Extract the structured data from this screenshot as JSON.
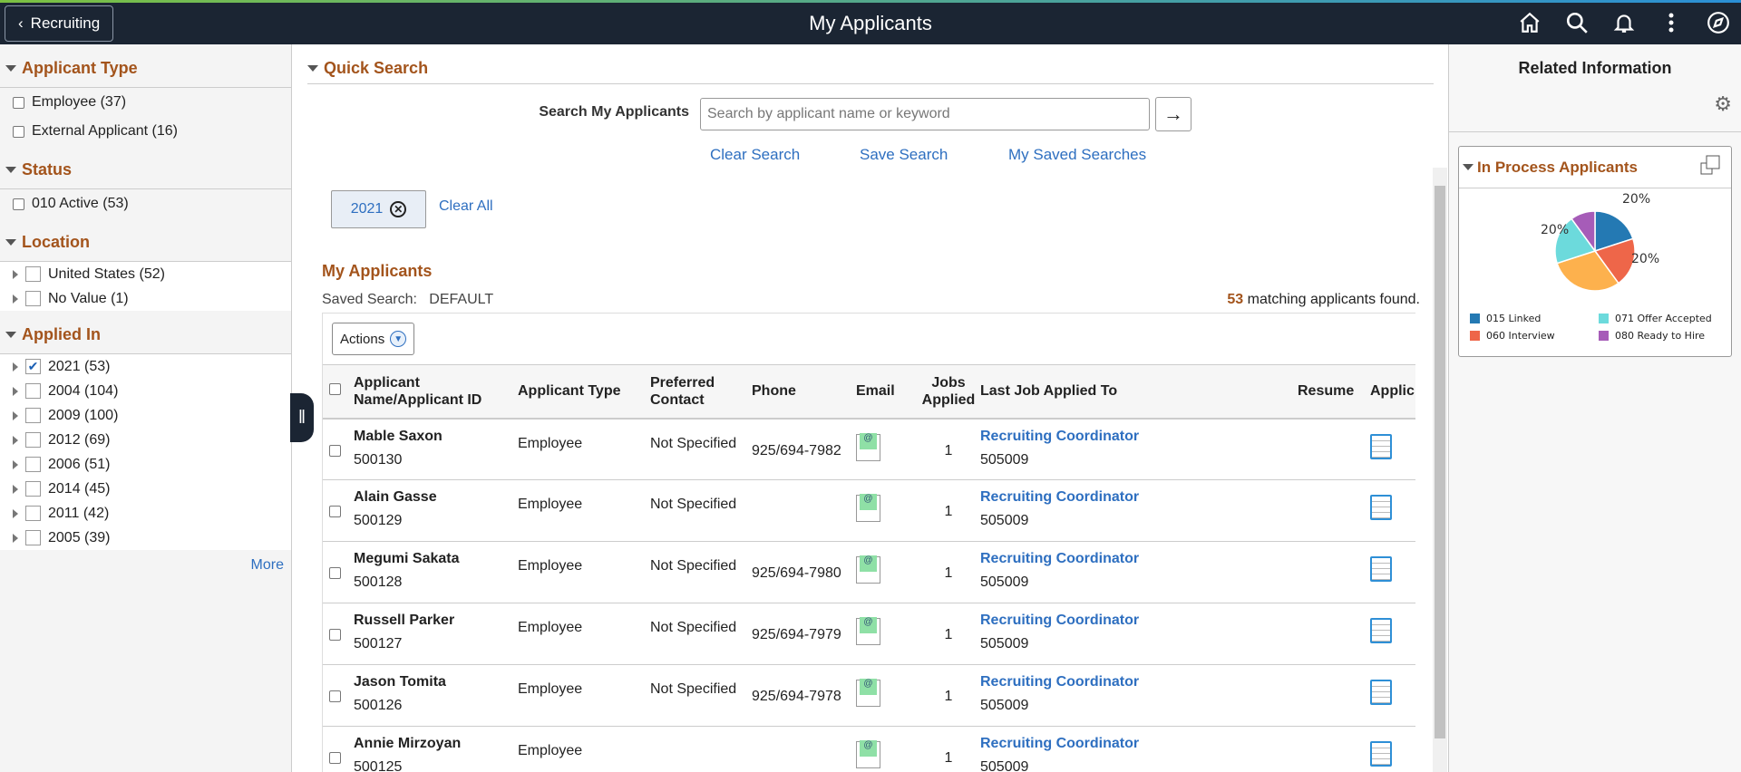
{
  "header": {
    "back_label": "Recruiting",
    "title": "My Applicants",
    "icons": [
      "home-icon",
      "search-icon",
      "bell-icon",
      "more-icon",
      "compass-icon"
    ]
  },
  "filters": {
    "applicant_type": {
      "title": "Applicant Type",
      "options": [
        "Employee (37)",
        "External Applicant (16)"
      ]
    },
    "status": {
      "title": "Status",
      "options": [
        "010 Active (53)"
      ]
    },
    "location": {
      "title": "Location",
      "options": [
        "United States (52)",
        "No Value (1)"
      ]
    },
    "applied_in": {
      "title": "Applied In",
      "options": [
        {
          "label": "2021 (53)",
          "checked": true
        },
        {
          "label": "2004 (104)",
          "checked": false
        },
        {
          "label": "2009 (100)",
          "checked": false
        },
        {
          "label": "2012 (69)",
          "checked": false
        },
        {
          "label": "2006 (51)",
          "checked": false
        },
        {
          "label": "2014 (45)",
          "checked": false
        },
        {
          "label": "2011 (42)",
          "checked": false
        },
        {
          "label": "2005 (39)",
          "checked": false
        }
      ]
    },
    "more": "More"
  },
  "quick_search": {
    "title": "Quick Search",
    "label": "Search My Applicants",
    "placeholder": "Search by applicant name or keyword",
    "clear": "Clear Search",
    "save": "Save Search",
    "saved": "My Saved Searches",
    "chip": "2021",
    "clear_all": "Clear All"
  },
  "applicants": {
    "title": "My Applicants",
    "saved_search_label": "Saved Search:",
    "saved_search_value": "DEFAULT",
    "count": "53",
    "found_text": "matching applicants found.",
    "actions": "Actions",
    "columns": [
      "Applicant Name/Applicant ID",
      "Applicant Type",
      "Preferred Contact",
      "Phone",
      "Email",
      "Jobs Applied",
      "Last Job Applied To",
      "Resume",
      "Applic"
    ],
    "rows": [
      {
        "name": "Mable Saxon",
        "id": "500130",
        "type": "Employee",
        "contact": "Not Specified",
        "phone": "925/694-7982",
        "jobs": "1",
        "job": "Recruiting Coordinator",
        "job_id": "505009"
      },
      {
        "name": "Alain Gasse",
        "id": "500129",
        "type": "Employee",
        "contact": "Not Specified",
        "phone": "",
        "jobs": "1",
        "job": "Recruiting Coordinator",
        "job_id": "505009"
      },
      {
        "name": "Megumi Sakata",
        "id": "500128",
        "type": "Employee",
        "contact": "Not Specified",
        "phone": "925/694-7980",
        "jobs": "1",
        "job": "Recruiting Coordinator",
        "job_id": "505009"
      },
      {
        "name": "Russell Parker",
        "id": "500127",
        "type": "Employee",
        "contact": "Not Specified",
        "phone": "925/694-7979",
        "jobs": "1",
        "job": "Recruiting Coordinator",
        "job_id": "505009"
      },
      {
        "name": "Jason Tomita",
        "id": "500126",
        "type": "Employee",
        "contact": "Not Specified",
        "phone": "925/694-7978",
        "jobs": "1",
        "job": "Recruiting Coordinator",
        "job_id": "505009"
      },
      {
        "name": "Annie Mirzoyan",
        "id": "500125",
        "type": "Employee",
        "contact": "",
        "phone": "",
        "jobs": "1",
        "job": "Recruiting Coordinator",
        "job_id": "505009"
      }
    ]
  },
  "related": {
    "title": "Related Information",
    "card_title": "In Process Applicants"
  },
  "chart_data": {
    "type": "pie",
    "title": "In Process Applicants",
    "slices": [
      {
        "label": "015 Linked",
        "value": 20,
        "color": "#2479b3",
        "data_label": "20%"
      },
      {
        "label": "060 Interview",
        "value": 20,
        "color": "#ee6649",
        "data_label": "20%"
      },
      {
        "label": "",
        "value": 30,
        "color": "#fdb14d",
        "data_label": ""
      },
      {
        "label": "071 Offer Accepted",
        "value": 20,
        "color": "#6cdadc",
        "data_label": "20%"
      },
      {
        "label": "080 Ready to Hire",
        "value": 10,
        "color": "#a65cb8",
        "data_label": ""
      }
    ],
    "legend": [
      "015 Linked",
      "071 Offer Accepted",
      "060 Interview",
      "080 Ready to Hire"
    ],
    "legend_colors": [
      "#2479b3",
      "#6cdadc",
      "#ee6649",
      "#a65cb8"
    ]
  }
}
